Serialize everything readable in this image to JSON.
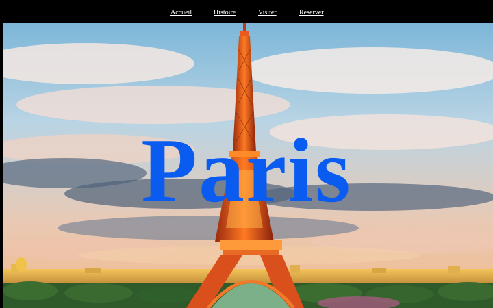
{
  "nav": {
    "items": [
      {
        "label": "Accueil"
      },
      {
        "label": "Histoire"
      },
      {
        "label": "Visiter"
      },
      {
        "label": "Réserver"
      }
    ]
  },
  "hero": {
    "title": "Paris",
    "title_color": "#0a5cf0",
    "image_subject": "eiffel-tower-at-sunset"
  },
  "colors": {
    "nav_background": "#000000",
    "nav_text": "#ffffff"
  }
}
